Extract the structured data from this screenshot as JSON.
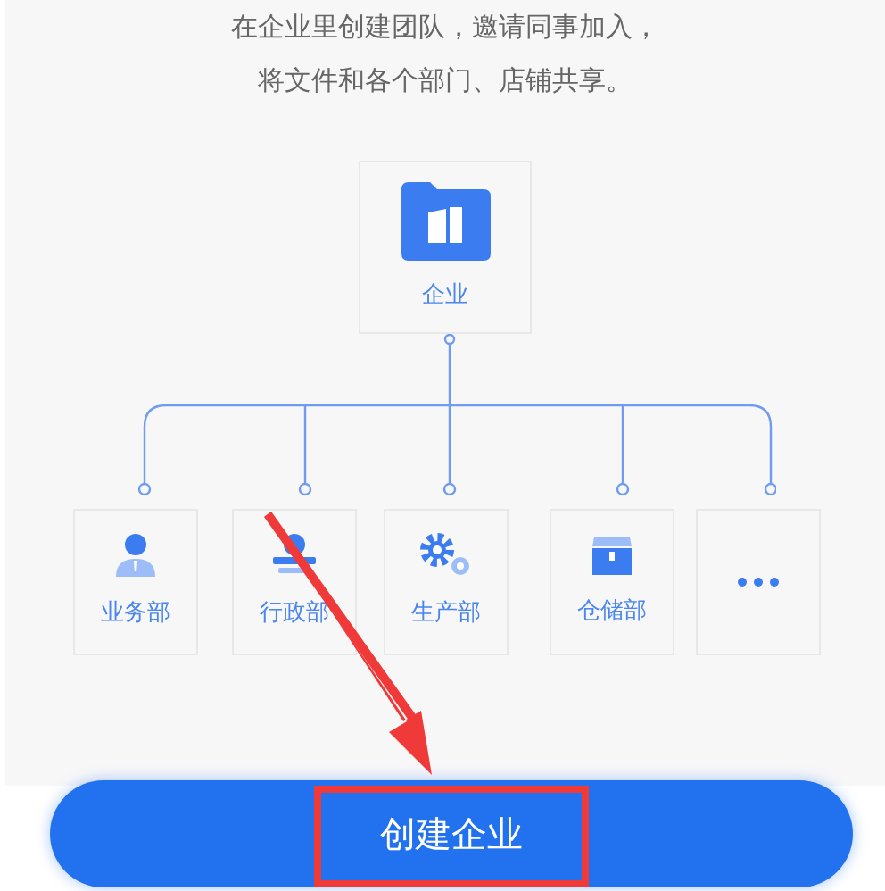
{
  "intro": [
    "在企业里创建团队，邀请同事加入，",
    "将文件和各个部门、店铺共享。"
  ],
  "root": {
    "label": "企业"
  },
  "departments": [
    {
      "kind": "person",
      "label": "业务部"
    },
    {
      "kind": "stamp",
      "label": "行政部"
    },
    {
      "kind": "gears",
      "label": "生产部"
    },
    {
      "kind": "box",
      "label": "仓储部"
    },
    {
      "kind": "more"
    }
  ],
  "button": {
    "label": "创建企业"
  }
}
